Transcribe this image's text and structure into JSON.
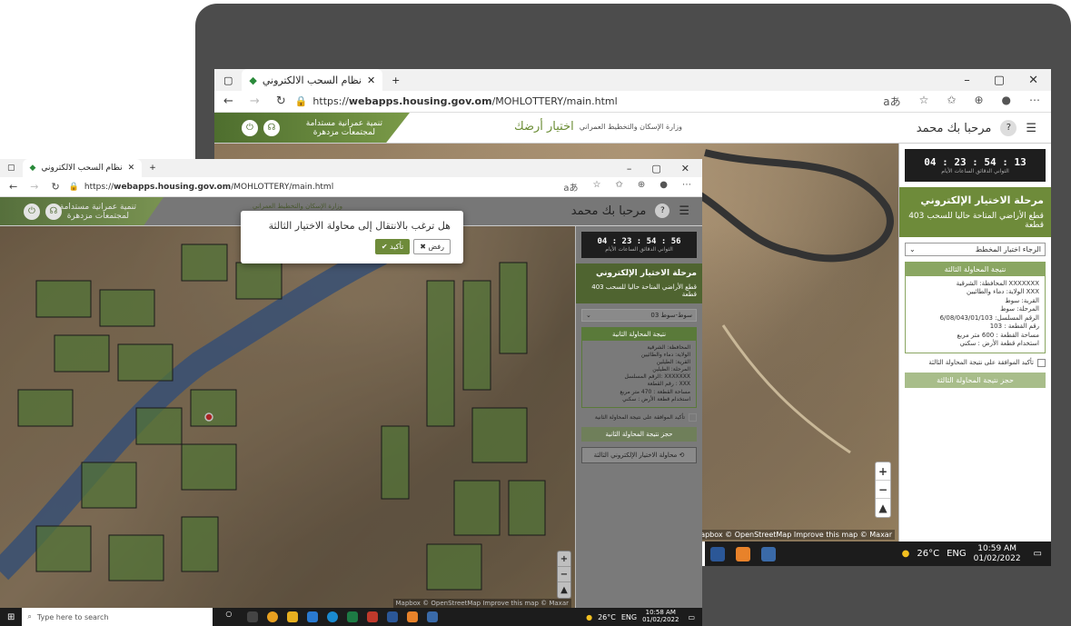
{
  "browser": {
    "tab_title": "نظام السحب الالكتروني",
    "url_prefix": "https://",
    "url_host": "webapps.housing.gov.om",
    "url_path": "/MOHLOTTERY/main.html",
    "minimize": "–",
    "restore": "▢",
    "close": "✕",
    "new_tab": "+"
  },
  "site": {
    "greeting": "مرحبا بك محمد",
    "banner_line1": "تنمية عمرانية مستدامة",
    "banner_line2": "لمجتمعات مزدهرة",
    "logo_text": "وزارة الإسكان والتخطيط العمراني",
    "logo_brand": "اختيار أرضك"
  },
  "back_panel": {
    "timer": "04 : 23 : 54 : 13",
    "timer_units": "الثواني الدقائق الساعات الأيام",
    "phase_title": "مرحلة الاختيار الإلكتروني",
    "phase_sub": "قطع الأراضي المتاحة حاليا للسحب 403 قطعة",
    "select_placeholder": "الرجاء اختيار المخطط",
    "result_title": "نتيجة المحاولة الثالثة",
    "result_lines": [
      "المحافظة: الشرقية XXXXXXX",
      "الولاية: دماء والطائيين XXX",
      "القرية: سوط",
      "المرحلة: سوط",
      "الرقم المسلسل: 6/08/043/01/103",
      "رقم القطعة : 103",
      "مساحة القطعة : 600 متر مربع",
      "استخدام قطعة الأرض : سكني"
    ],
    "confirm_label": "تأكيد الموافقة على نتيجة المحاولة الثالثة",
    "book_button": "حجز نتيجة المحاولة الثالثة"
  },
  "front_panel": {
    "timer": "04 : 23 : 54 : 56",
    "timer_units": "الثواني الدقائق الساعات الأيام",
    "phase_title": "مرحلة الاختيار الإلكتروني",
    "phase_sub": "قطع الأراضي المتاحة حاليا للسحب 403 قطعة",
    "select_value": "سوط-سوط 03",
    "result_title": "نتيجة المحاولة الثانية",
    "result_lines": [
      "المحافظة: الشرقية",
      "الولاية: دماء والطائيين",
      "القرية: الطيلين",
      "المرحلة: الطيلين",
      "الرقم المسلسل: XXXXXXX",
      "رقم القطعة : XXX",
      "مساحة القطعة : 470 متر مربع",
      "استخدام قطعة الأرض : سكني"
    ],
    "confirm_label": "تأكيد الموافقة على نتيجة المحاولة الثانية",
    "book_button": "حجز نتيجة المحاولة الثانية",
    "third_attempt_button": "محاولة الاختيار الإلكتروني الثالثة"
  },
  "modal": {
    "question": "هل ترغب بالانتقال إلى محاولة الاختيار الثالثة",
    "confirm": "✔ تأكيد",
    "reject": "✖ رفض"
  },
  "map": {
    "attribution": "Mapbox © OpenStreetMap Improve this map © Maxar",
    "zoom_in": "+",
    "zoom_out": "−",
    "compass": "▲"
  },
  "taskbar_back": {
    "weather": "26°C",
    "lang": "ENG",
    "time": "10:59 AM",
    "date": "01/02/2022"
  },
  "taskbar_front": {
    "search_placeholder": "Type here to search",
    "weather": "26°C",
    "lang": "ENG",
    "time": "10:58 AM",
    "date": "01/02/2022"
  }
}
